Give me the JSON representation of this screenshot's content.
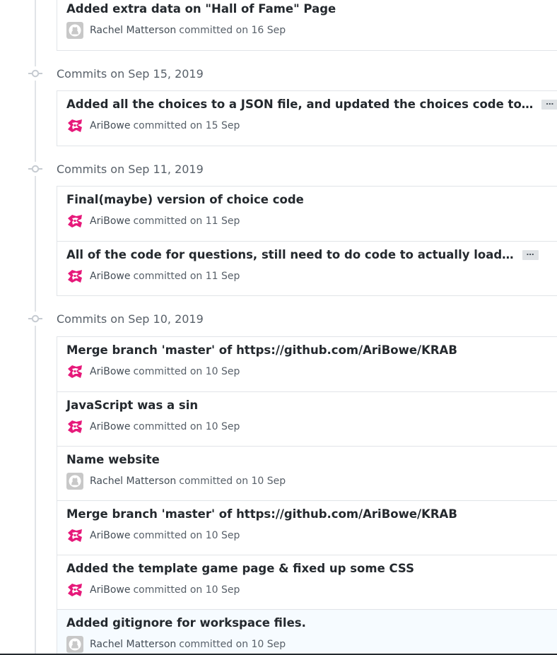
{
  "groups": [
    {
      "title": "",
      "commits": [
        {
          "message": "Added extra data on \"Hall of Fame\" Page",
          "author": "Rachel Matterson",
          "committed": "committed on 16 Sep",
          "avatar": "github-default-avatar-icon",
          "truncated": false
        }
      ]
    },
    {
      "title": "Commits on Sep 15, 2019",
      "commits": [
        {
          "message": "Added all the choices to a JSON file, and updated the choices code to…",
          "author": "AriBowe",
          "committed": "committed on 15 Sep",
          "avatar": "aribowe-identicon-avatar",
          "truncated": true
        }
      ]
    },
    {
      "title": "Commits on Sep 11, 2019",
      "commits": [
        {
          "message": "Final(maybe) version of choice code",
          "author": "AriBowe",
          "committed": "committed on 11 Sep",
          "avatar": "aribowe-identicon-avatar",
          "truncated": false
        },
        {
          "message": "All of the code for questions, still need to do code to actually load…",
          "author": "AriBowe",
          "committed": "committed on 11 Sep",
          "avatar": "aribowe-identicon-avatar",
          "truncated": true
        }
      ]
    },
    {
      "title": "Commits on Sep 10, 2019",
      "commits": [
        {
          "message": "Merge branch 'master' of https://github.com/AriBowe/KRAB",
          "author": "AriBowe",
          "committed": "committed on 10 Sep",
          "avatar": "aribowe-identicon-avatar",
          "truncated": false
        },
        {
          "message": "JavaScript was a sin",
          "author": "AriBowe",
          "committed": "committed on 10 Sep",
          "avatar": "aribowe-identicon-avatar",
          "truncated": false
        },
        {
          "message": "Name website",
          "author": "Rachel Matterson",
          "committed": "committed on 10 Sep",
          "avatar": "github-default-avatar-icon",
          "truncated": false
        },
        {
          "message": "Merge branch 'master' of https://github.com/AriBowe/KRAB",
          "author": "AriBowe",
          "committed": "committed on 10 Sep",
          "avatar": "aribowe-identicon-avatar",
          "truncated": false
        },
        {
          "message": "Added the template game page & fixed up some CSS",
          "author": "AriBowe",
          "committed": "committed on 10 Sep",
          "avatar": "aribowe-identicon-avatar",
          "truncated": false
        },
        {
          "message": "Added gitignore for workspace files.",
          "author": "Rachel Matterson",
          "committed": "committed on 10 Sep",
          "avatar": "github-default-avatar-icon",
          "truncated": false,
          "highlighted": true
        }
      ]
    }
  ],
  "ui": {
    "ellipsis_label": "…",
    "colors": {
      "accent_pink": "#e6197a",
      "text_primary": "#24292e",
      "text_muted": "#586069",
      "border": "#e1e4e8",
      "highlight_bg": "#f6fbff"
    }
  }
}
